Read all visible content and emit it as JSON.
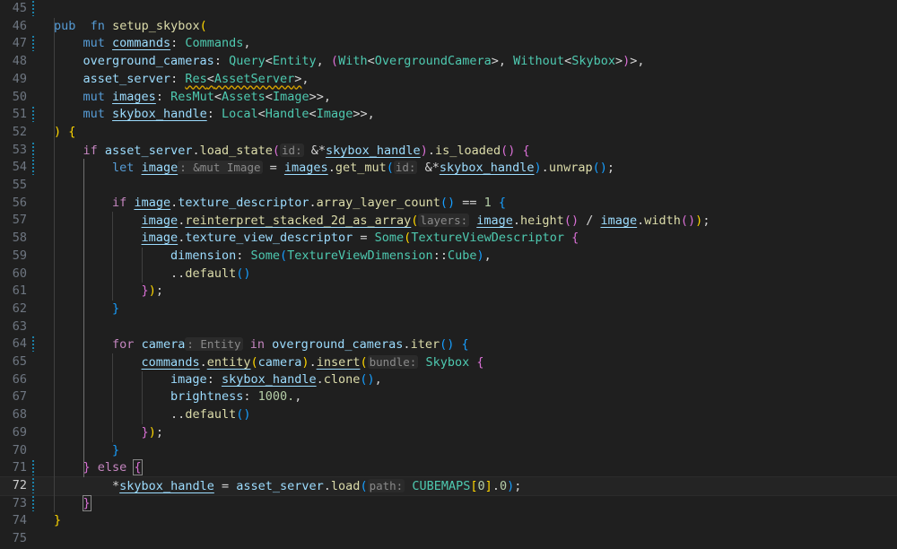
{
  "editor": {
    "language": "rust",
    "active_line": 72,
    "lines": [
      {
        "n": "45",
        "tokens": []
      },
      {
        "n": "46",
        "tokens": [
          [
            "kw",
            "pub"
          ],
          [
            "",
            "  "
          ],
          [
            "kw",
            "fn"
          ],
          [
            "",
            " "
          ],
          [
            "fn",
            "setup_skybox"
          ],
          [
            "b1",
            "("
          ]
        ]
      },
      {
        "n": "47",
        "tokens": [
          [
            "",
            "    "
          ],
          [
            "kw",
            "mut"
          ],
          [
            "",
            " "
          ],
          [
            "var ul",
            "commands"
          ],
          [
            "op",
            ": "
          ],
          [
            "ty",
            "Commands"
          ],
          [
            "op",
            ","
          ]
        ]
      },
      {
        "n": "48",
        "tokens": [
          [
            "",
            "    "
          ],
          [
            "var",
            "overground_cameras"
          ],
          [
            "op",
            ": "
          ],
          [
            "ty",
            "Query"
          ],
          [
            "op",
            "<"
          ],
          [
            "ty",
            "Entity"
          ],
          [
            "op",
            ", "
          ],
          [
            "b2",
            "("
          ],
          [
            "ty",
            "With"
          ],
          [
            "op",
            "<"
          ],
          [
            "ty",
            "OvergroundCamera"
          ],
          [
            "op",
            ">, "
          ],
          [
            "ty",
            "Without"
          ],
          [
            "op",
            "<"
          ],
          [
            "ty",
            "Skybox"
          ],
          [
            "op",
            ">"
          ],
          [
            "b2",
            ")"
          ],
          [
            "op",
            ">,"
          ]
        ]
      },
      {
        "n": "49",
        "tokens": [
          [
            "",
            "    "
          ],
          [
            "var",
            "asset_server"
          ],
          [
            "op",
            ": "
          ],
          [
            "ty warn",
            "Res"
          ],
          [
            "op warn",
            "<"
          ],
          [
            "ty warn",
            "AssetServer"
          ],
          [
            "op warn",
            ">"
          ],
          [
            "op",
            ","
          ]
        ]
      },
      {
        "n": "50",
        "tokens": [
          [
            "",
            "    "
          ],
          [
            "kw",
            "mut"
          ],
          [
            "",
            " "
          ],
          [
            "var ul",
            "images"
          ],
          [
            "op",
            ": "
          ],
          [
            "ty",
            "ResMut"
          ],
          [
            "op",
            "<"
          ],
          [
            "ty",
            "Assets"
          ],
          [
            "op",
            "<"
          ],
          [
            "ty",
            "Image"
          ],
          [
            "op",
            ">>,"
          ]
        ]
      },
      {
        "n": "51",
        "tokens": [
          [
            "",
            "    "
          ],
          [
            "kw",
            "mut"
          ],
          [
            "",
            " "
          ],
          [
            "var ul",
            "skybox_handle"
          ],
          [
            "op",
            ": "
          ],
          [
            "ty",
            "Local"
          ],
          [
            "op",
            "<"
          ],
          [
            "ty",
            "Handle"
          ],
          [
            "op",
            "<"
          ],
          [
            "ty",
            "Image"
          ],
          [
            "op",
            ">>,"
          ]
        ]
      },
      {
        "n": "52",
        "tokens": [
          [
            "b1",
            ")"
          ],
          [
            "",
            " "
          ],
          [
            "b1",
            "{"
          ]
        ]
      },
      {
        "n": "53",
        "tokens": [
          [
            "",
            "    "
          ],
          [
            "ctrl",
            "if"
          ],
          [
            "",
            " "
          ],
          [
            "var",
            "asset_server"
          ],
          [
            "op",
            "."
          ],
          [
            "fn",
            "load_state"
          ],
          [
            "b2",
            "("
          ],
          [
            "hint",
            "id:"
          ],
          [
            "",
            " "
          ],
          [
            "op",
            "&*"
          ],
          [
            "var ul",
            "skybox_handle"
          ],
          [
            "b2",
            ")"
          ],
          [
            "op",
            "."
          ],
          [
            "fn",
            "is_loaded"
          ],
          [
            "b2",
            "()"
          ],
          [
            "",
            " "
          ],
          [
            "b2",
            "{"
          ]
        ]
      },
      {
        "n": "54",
        "tokens": [
          [
            "",
            "        "
          ],
          [
            "kw",
            "let"
          ],
          [
            "",
            " "
          ],
          [
            "var ul",
            "image"
          ],
          [
            "hint",
            ": &mut Image"
          ],
          [
            "op",
            " = "
          ],
          [
            "var ul",
            "images"
          ],
          [
            "op",
            "."
          ],
          [
            "fn",
            "get_mut"
          ],
          [
            "b3",
            "("
          ],
          [
            "hint",
            "id:"
          ],
          [
            "",
            " "
          ],
          [
            "op",
            "&*"
          ],
          [
            "var ul",
            "skybox_handle"
          ],
          [
            "b3",
            ")"
          ],
          [
            "op",
            "."
          ],
          [
            "fn",
            "unwrap"
          ],
          [
            "b3",
            "()"
          ],
          [
            "op",
            ";"
          ]
        ]
      },
      {
        "n": "55",
        "tokens": []
      },
      {
        "n": "56",
        "tokens": [
          [
            "",
            "        "
          ],
          [
            "ctrl",
            "if"
          ],
          [
            "",
            " "
          ],
          [
            "var ul",
            "image"
          ],
          [
            "op",
            "."
          ],
          [
            "var",
            "texture_descriptor"
          ],
          [
            "op",
            "."
          ],
          [
            "fn",
            "array_layer_count"
          ],
          [
            "b3",
            "()"
          ],
          [
            "op",
            " == "
          ],
          [
            "num",
            "1"
          ],
          [
            "",
            " "
          ],
          [
            "b3",
            "{"
          ]
        ]
      },
      {
        "n": "57",
        "tokens": [
          [
            "",
            "            "
          ],
          [
            "var ul",
            "image"
          ],
          [
            "op",
            "."
          ],
          [
            "fn ul",
            "reinterpret_stacked_2d_as_array"
          ],
          [
            "b1",
            "("
          ],
          [
            "hint",
            "layers:"
          ],
          [
            "",
            " "
          ],
          [
            "var ul",
            "image"
          ],
          [
            "op",
            "."
          ],
          [
            "fn",
            "height"
          ],
          [
            "b2",
            "()"
          ],
          [
            "op",
            " / "
          ],
          [
            "var ul",
            "image"
          ],
          [
            "op",
            "."
          ],
          [
            "fn",
            "width"
          ],
          [
            "b2",
            "()"
          ],
          [
            "b1",
            ")"
          ],
          [
            "op",
            ";"
          ]
        ]
      },
      {
        "n": "58",
        "tokens": [
          [
            "",
            "            "
          ],
          [
            "var ul",
            "image"
          ],
          [
            "op",
            "."
          ],
          [
            "var",
            "texture_view_descriptor"
          ],
          [
            "op",
            " = "
          ],
          [
            "ty",
            "Some"
          ],
          [
            "b1",
            "("
          ],
          [
            "ty",
            "TextureViewDescriptor"
          ],
          [
            "",
            " "
          ],
          [
            "b2",
            "{"
          ]
        ]
      },
      {
        "n": "59",
        "tokens": [
          [
            "",
            "                "
          ],
          [
            "var",
            "dimension"
          ],
          [
            "op",
            ": "
          ],
          [
            "ty",
            "Some"
          ],
          [
            "b3",
            "("
          ],
          [
            "ty",
            "TextureViewDimension"
          ],
          [
            "op",
            "::"
          ],
          [
            "ty",
            "Cube"
          ],
          [
            "b3",
            ")"
          ],
          [
            "op",
            ","
          ]
        ]
      },
      {
        "n": "60",
        "tokens": [
          [
            "",
            "                "
          ],
          [
            "op",
            ".."
          ],
          [
            "fn",
            "default"
          ],
          [
            "b3",
            "()"
          ]
        ]
      },
      {
        "n": "61",
        "tokens": [
          [
            "",
            "            "
          ],
          [
            "b2",
            "}"
          ],
          [
            "b1",
            ")"
          ],
          [
            "op",
            ";"
          ]
        ]
      },
      {
        "n": "62",
        "tokens": [
          [
            "",
            "        "
          ],
          [
            "b3",
            "}"
          ]
        ]
      },
      {
        "n": "63",
        "tokens": []
      },
      {
        "n": "64",
        "tokens": [
          [
            "",
            "        "
          ],
          [
            "ctrl",
            "for"
          ],
          [
            "",
            " "
          ],
          [
            "var",
            "camera"
          ],
          [
            "hint",
            ": Entity"
          ],
          [
            "",
            " "
          ],
          [
            "ctrl",
            "in"
          ],
          [
            "",
            " "
          ],
          [
            "var",
            "overground_cameras"
          ],
          [
            "op",
            "."
          ],
          [
            "fn",
            "iter"
          ],
          [
            "b3",
            "()"
          ],
          [
            "",
            " "
          ],
          [
            "b3",
            "{"
          ]
        ]
      },
      {
        "n": "65",
        "tokens": [
          [
            "",
            "            "
          ],
          [
            "var ul",
            "commands"
          ],
          [
            "op",
            "."
          ],
          [
            "fn ul",
            "entity"
          ],
          [
            "b1",
            "("
          ],
          [
            "var",
            "camera"
          ],
          [
            "b1",
            ")"
          ],
          [
            "op",
            "."
          ],
          [
            "fn ul",
            "insert"
          ],
          [
            "b1",
            "("
          ],
          [
            "hint",
            "bundle:"
          ],
          [
            "",
            " "
          ],
          [
            "ty",
            "Skybox"
          ],
          [
            "",
            " "
          ],
          [
            "b2",
            "{"
          ]
        ]
      },
      {
        "n": "66",
        "tokens": [
          [
            "",
            "                "
          ],
          [
            "var",
            "image"
          ],
          [
            "op",
            ": "
          ],
          [
            "var ul",
            "skybox_handle"
          ],
          [
            "op",
            "."
          ],
          [
            "fn",
            "clone"
          ],
          [
            "b3",
            "()"
          ],
          [
            "op",
            ","
          ]
        ]
      },
      {
        "n": "67",
        "tokens": [
          [
            "",
            "                "
          ],
          [
            "var",
            "brightness"
          ],
          [
            "op",
            ": "
          ],
          [
            "num",
            "1000."
          ],
          [
            "op",
            ","
          ]
        ]
      },
      {
        "n": "68",
        "tokens": [
          [
            "",
            "                "
          ],
          [
            "op",
            ".."
          ],
          [
            "fn",
            "default"
          ],
          [
            "b3",
            "()"
          ]
        ]
      },
      {
        "n": "69",
        "tokens": [
          [
            "",
            "            "
          ],
          [
            "b2",
            "}"
          ],
          [
            "b1",
            ")"
          ],
          [
            "op",
            ";"
          ]
        ]
      },
      {
        "n": "70",
        "tokens": [
          [
            "",
            "        "
          ],
          [
            "b3",
            "}"
          ]
        ]
      },
      {
        "n": "71",
        "tokens": [
          [
            "",
            "    "
          ],
          [
            "b2",
            "}"
          ],
          [
            "",
            " "
          ],
          [
            "ctrl",
            "else"
          ],
          [
            "",
            " "
          ],
          [
            "b2 box",
            "{"
          ]
        ]
      },
      {
        "n": "72",
        "tokens": [
          [
            "",
            "        "
          ],
          [
            "op",
            "*"
          ],
          [
            "var ul",
            "skybox_handle"
          ],
          [
            "op",
            " = "
          ],
          [
            "var",
            "asset_server"
          ],
          [
            "op",
            "."
          ],
          [
            "fn",
            "load"
          ],
          [
            "b3",
            "("
          ],
          [
            "hint",
            "path:"
          ],
          [
            "",
            " "
          ],
          [
            "ty",
            "CUBEMAPS"
          ],
          [
            "b1",
            "["
          ],
          [
            "num",
            "0"
          ],
          [
            "b1",
            "]"
          ],
          [
            "op",
            "."
          ],
          [
            "num",
            "0"
          ],
          [
            "b3",
            ")"
          ],
          [
            "op",
            ";"
          ]
        ]
      },
      {
        "n": "73",
        "tokens": [
          [
            "",
            "    "
          ],
          [
            "b2 box",
            "}"
          ]
        ]
      },
      {
        "n": "74",
        "tokens": [
          [
            "b1",
            "}"
          ]
        ]
      },
      {
        "n": "75",
        "tokens": []
      }
    ],
    "modified_lines": [
      "45",
      "47",
      "51",
      "53",
      "54",
      "64",
      "71",
      "72",
      "73"
    ]
  }
}
